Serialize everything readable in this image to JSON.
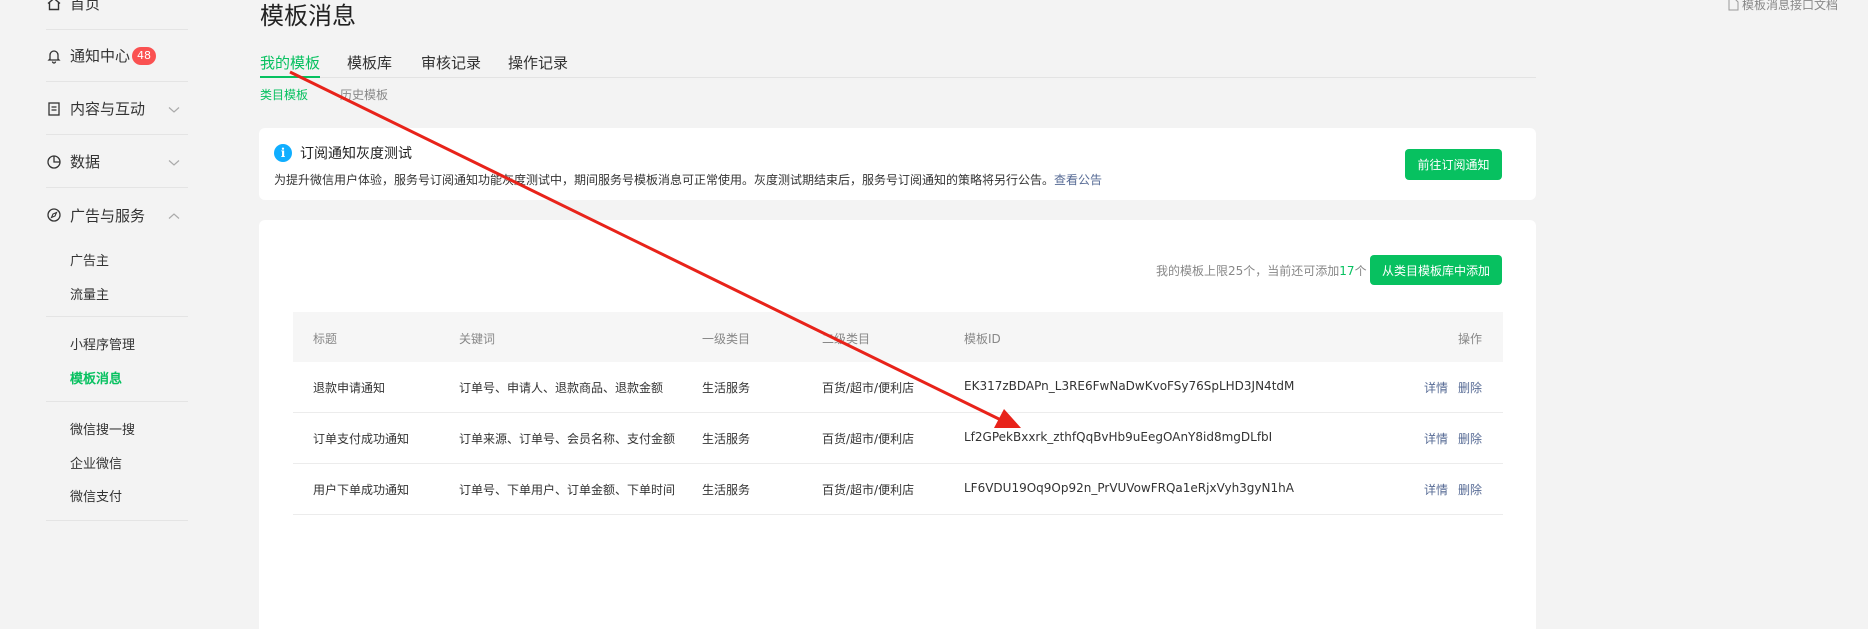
{
  "sidebar": {
    "home": "首页",
    "notice": "通知中心",
    "notice_badge": "48",
    "content": "内容与互动",
    "data": "数据",
    "ads": "广告与服务",
    "advertiser": "广告主",
    "traffic": "流量主",
    "miniprogram": "小程序管理",
    "template": "模板消息",
    "wechat_search": "微信搜一搜",
    "work_wechat": "企业微信",
    "wechat_pay": "微信支付"
  },
  "header": {
    "title": "模板消息",
    "doc_link": "模板消息接口文档"
  },
  "tabs": [
    "我的模板",
    "模板库",
    "审核记录",
    "操作记录"
  ],
  "subtabs": [
    "类目模板",
    "历史模板"
  ],
  "notice": {
    "title": "订阅通知灰度测试",
    "text": "为提升微信用户体验，服务号订阅通知功能灰度测试中，期间服务号模板消息可正常使用。灰度测试期结束后，服务号订阅通知的策略将另行公告。",
    "link": "查看公告",
    "button": "前往订阅通知"
  },
  "limit": {
    "prefix": "我的模板上限25个，当前还可添加",
    "count": "17",
    "suffix": "个",
    "add_button": "从类目模板库中添加"
  },
  "table": {
    "headers": [
      "标题",
      "关键词",
      "一级类目",
      "二级类目",
      "模板ID",
      "操作"
    ],
    "rows": [
      {
        "title": "退款申请通知",
        "keywords": "订单号、申请人、退款商品、退款金额",
        "cat1": "生活服务",
        "cat2": "百货/超市/便利店",
        "id": "EK317zBDAPn_L3RE6FwNaDwKvoFSy76SpLHD3JN4tdM",
        "detail": "详情",
        "delete": "删除"
      },
      {
        "title": "订单支付成功通知",
        "keywords": "订单来源、订单号、会员名称、支付金额",
        "cat1": "生活服务",
        "cat2": "百货/超市/便利店",
        "id": "Lf2GPekBxxrk_zthfQqBvHb9uEegOAnY8id8mgDLfbI",
        "detail": "详情",
        "delete": "删除"
      },
      {
        "title": "用户下单成功通知",
        "keywords": "订单号、下单用户、订单金额、下单时间",
        "cat1": "生活服务",
        "cat2": "百货/超市/便利店",
        "id": "LF6VDU19Oq9Op92n_PrVUVowFRQa1eRjxVyh3gyN1hA",
        "detail": "详情",
        "delete": "删除"
      }
    ]
  },
  "colors": {
    "accent": "#07c160",
    "link": "#576b95",
    "badge": "#fa5151",
    "arrow": "#e8231a"
  }
}
